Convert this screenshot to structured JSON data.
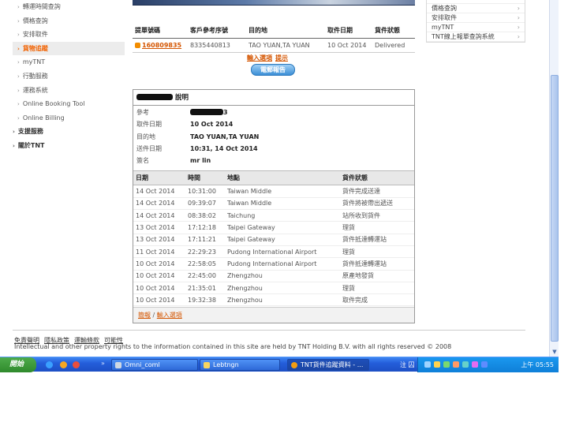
{
  "left_nav": [
    {
      "label": "轉運時間查詢",
      "active": false,
      "top": false
    },
    {
      "label": "價格查詢",
      "active": false,
      "top": false
    },
    {
      "label": "安排取件",
      "active": false,
      "top": false
    },
    {
      "label": "貨物追蹤",
      "active": true,
      "top": false
    },
    {
      "label": "myTNT",
      "active": false,
      "top": false
    },
    {
      "label": "行動服務",
      "active": false,
      "top": false
    },
    {
      "label": "運務系統",
      "active": false,
      "top": false
    },
    {
      "label": "Online Booking Tool",
      "active": false,
      "top": false
    },
    {
      "label": "Online Billing",
      "active": false,
      "top": false
    },
    {
      "label": "支援服務",
      "active": false,
      "top": true
    },
    {
      "label": "關於TNT",
      "active": false,
      "top": true
    }
  ],
  "right_links": [
    "價格查詢",
    "安排取件",
    "myTNT",
    "TNT線上報單查詢系統"
  ],
  "summary": {
    "headers": [
      "提單號碼",
      "客戶參考序號",
      "目的地",
      "取件日期",
      "貨件狀態"
    ],
    "row": {
      "consignment": "160809835",
      "reference": "8335440813",
      "destination": "TAO YUAN,TA YUAN",
      "pickup_date": "10 Oct 2014",
      "status": "Delivered"
    }
  },
  "links_row": {
    "enter_options": "輸入選項",
    "hint": "提示"
  },
  "email_report": "電郵報告",
  "detail": {
    "title_suffix": " 說明",
    "info": [
      {
        "label": "參考",
        "value": "3",
        "redacted": true
      },
      {
        "label": "取件日期",
        "value": "10 Oct 2014",
        "redacted": false
      },
      {
        "label": "目的地",
        "value": "TAO YUAN,TA YUAN",
        "redacted": false
      },
      {
        "label": "送件日期",
        "value": "10:31, 14 Oct 2014",
        "redacted": false
      },
      {
        "label": "簽名",
        "value": "mr lin",
        "redacted": false
      }
    ],
    "event_headers": [
      "日期",
      "時間",
      "地點",
      "貨件狀態"
    ],
    "events": [
      [
        "14 Oct 2014",
        "10:31:00",
        "Taiwan Middle",
        "貨件完成送達"
      ],
      [
        "14 Oct 2014",
        "09:39:07",
        "Taiwan Middle",
        "貨件將被帶出遞送"
      ],
      [
        "14 Oct 2014",
        "08:38:02",
        "Taichung",
        "站所收到貨件"
      ],
      [
        "13 Oct 2014",
        "17:12:18",
        "Taipei Gateway",
        "理貨"
      ],
      [
        "13 Oct 2014",
        "17:11:21",
        "Taipei Gateway",
        "貨件抵達轉運站"
      ],
      [
        "11 Oct 2014",
        "22:29:23",
        "Pudong International Airport",
        "理貨"
      ],
      [
        "10 Oct 2014",
        "22:58:05",
        "Pudong International Airport",
        "貨件抵達轉運站"
      ],
      [
        "10 Oct 2014",
        "22:45:00",
        "Zhengzhou",
        "原產地發貨"
      ],
      [
        "10 Oct 2014",
        "21:35:01",
        "Zhengzhou",
        "理貨"
      ],
      [
        "10 Oct 2014",
        "19:32:38",
        "Zhengzhou",
        "取件完成"
      ]
    ],
    "footer": {
      "overview": "簡報",
      "separator": " / ",
      "enter_options": "輸入選項"
    }
  },
  "footer": {
    "links": [
      "免責聲明",
      "隱私政策",
      "運輸條款",
      "可能性"
    ],
    "copyright": "Intellectual and other property rights to the information contained in this site are held by TNT Holding B.V. with all rights reserved © 2008"
  },
  "taskbar": {
    "start": "開始",
    "tasks": [
      "Omni_coml",
      "Lebtngn",
      "TNT貨件追蹤資料 - ..."
    ],
    "ime": "注 囚 ■",
    "clock": "上午 05:55"
  }
}
